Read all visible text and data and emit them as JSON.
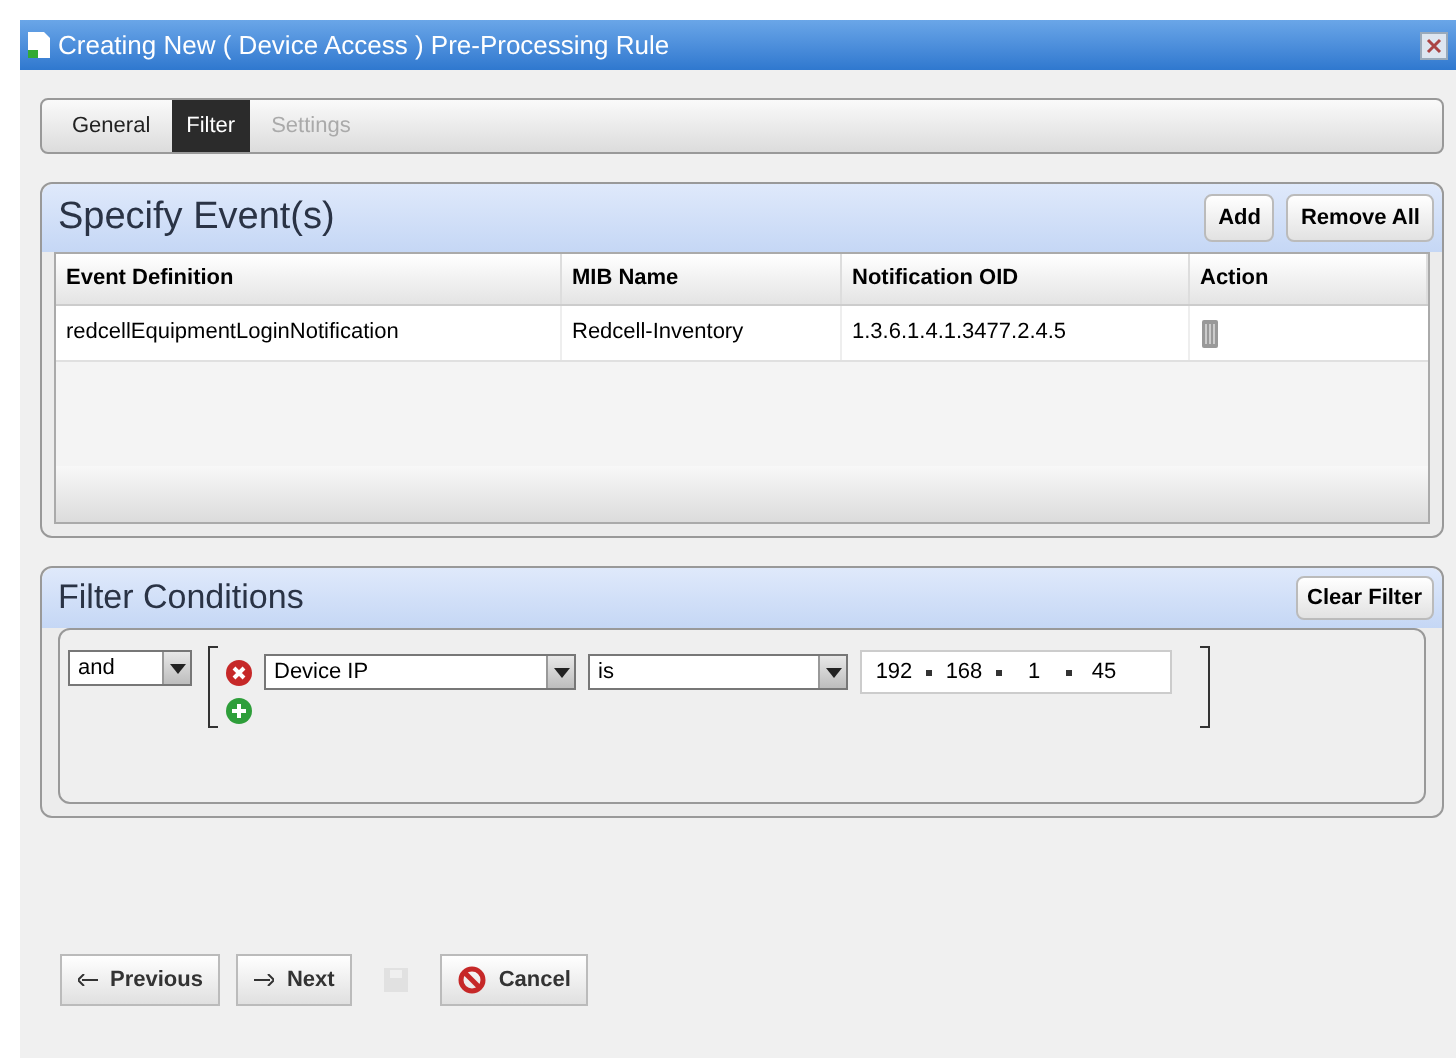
{
  "window": {
    "title": "Creating New ( Device Access ) Pre-Processing Rule"
  },
  "tabs": [
    {
      "label": "General",
      "selected": false,
      "disabled": false
    },
    {
      "label": "Filter",
      "selected": true,
      "disabled": false
    },
    {
      "label": "Settings",
      "selected": false,
      "disabled": true
    }
  ],
  "events_panel": {
    "title": "Specify Event(s)",
    "buttons": [
      "Add",
      "Remove All"
    ],
    "columns": [
      "Event Definition",
      "MIB Name",
      "Notification OID",
      "Action"
    ],
    "rows": [
      {
        "cells": [
          "redcellEquipmentLoginNotification",
          "Redcell-Inventory",
          "1.3.6.1.4.1.3477.2.4.5"
        ]
      }
    ]
  },
  "filter_panel": {
    "title": "Filter Conditions",
    "button": "Clear Filter",
    "operator": "and",
    "conditions": [
      {
        "field": "Device IP",
        "comparison": "is",
        "value": [
          "192",
          "168",
          "1",
          "45"
        ]
      }
    ]
  },
  "footer": [
    {
      "label": "Previous",
      "kind": "previous",
      "disabled": false
    },
    {
      "label": "Next",
      "kind": "next",
      "disabled": false
    },
    {
      "kind": "save",
      "disabled": true
    },
    {
      "label": "Cancel",
      "kind": "cancel",
      "disabled": false
    }
  ]
}
